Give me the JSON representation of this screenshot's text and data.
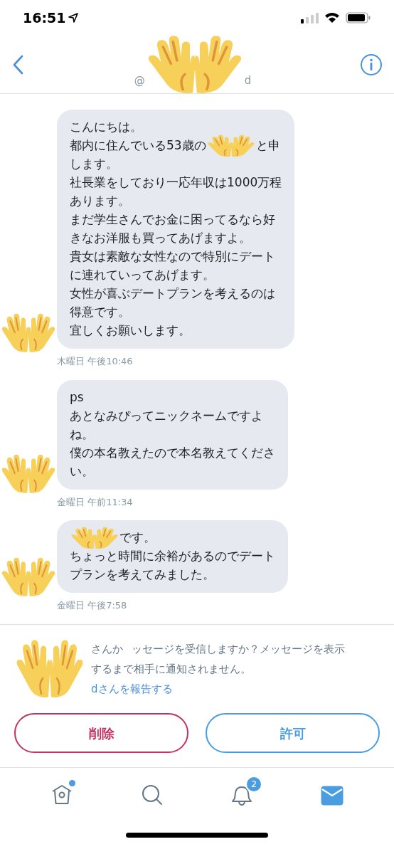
{
  "status_bar": {
    "time": "16:51"
  },
  "header": {
    "handle_parts": [
      "@",
      "d"
    ]
  },
  "messages": [
    {
      "lines": [
        [
          "こんにちは。"
        ],
        [
          "都内に住んでいる53歳の",
          {
            "kind": "covered"
          },
          "と申"
        ],
        [
          "します。"
        ],
        [
          "社長業をしており一応年収は1000万程"
        ],
        [
          "あります。"
        ],
        [
          "まだ学生さんでお金に困ってるなら好"
        ],
        [
          "きなお洋服も買ってあげますよ。"
        ],
        [
          "貴女は素敵な女性なので特別にデート"
        ],
        [
          "に連れていってあげます。"
        ],
        [
          "女性が喜ぶデートプランを考えるのは"
        ],
        [
          "得意です。"
        ],
        [
          "宜しくお願いします。"
        ]
      ],
      "timestamp": "木曜日 午後10:46"
    },
    {
      "lines": [
        [
          "ps"
        ],
        [
          "あとなみぴってニックネームですよ"
        ],
        [
          "ね。"
        ],
        [
          "僕の本名教えたので本名教えてくださ"
        ],
        [
          "い。"
        ]
      ],
      "timestamp": "金曜日 午前11:34"
    },
    {
      "lines": [
        [
          {
            "kind": "covered"
          },
          "です。"
        ],
        [
          "ちょっと時間に余裕があるのでデート"
        ],
        [
          "プランを考えてみました。"
        ]
      ],
      "timestamp": "金曜日 午後7:58"
    }
  ],
  "request": {
    "lines": [
      [
        "さんか",
        "ッセージを受信しますか？メッセージを表示"
      ],
      [
        "するまで相手に通知されません。"
      ]
    ],
    "report_link": "dさんを報告する"
  },
  "buttons": [
    {
      "label": "削除",
      "kind": "destructive"
    },
    {
      "label": "許可",
      "kind": "primary"
    }
  ],
  "tabs": [
    {
      "kind": "home",
      "selected": false,
      "dot": true
    },
    {
      "kind": "search",
      "selected": false
    },
    {
      "kind": "notifications",
      "selected": false,
      "badge": "2"
    },
    {
      "kind": "messages",
      "selected": true
    }
  ]
}
